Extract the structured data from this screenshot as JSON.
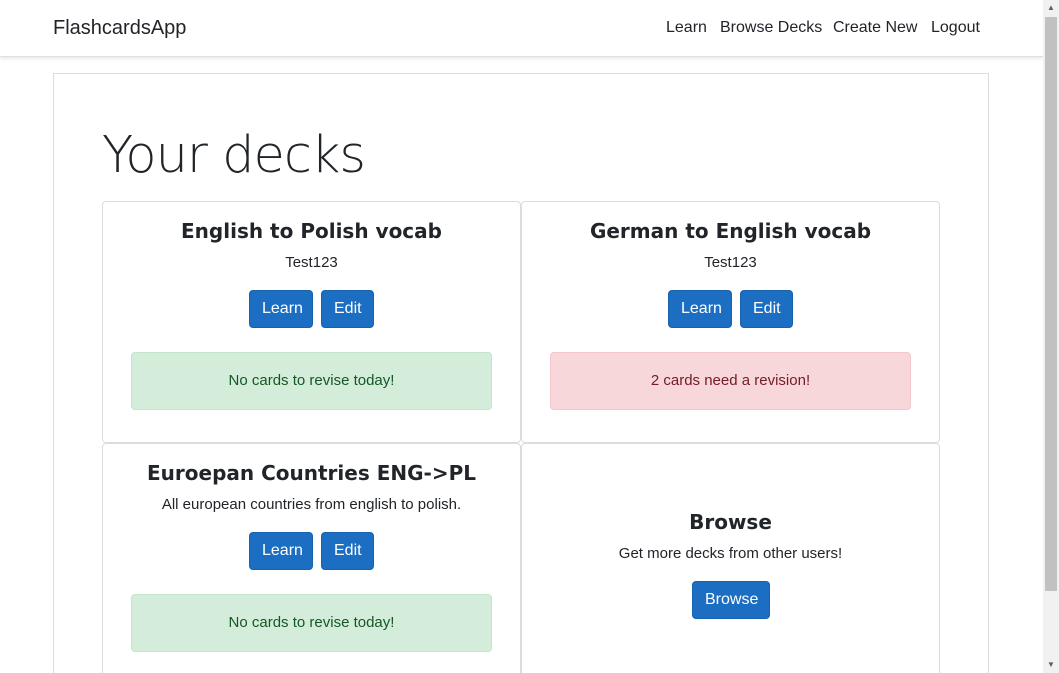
{
  "nav": {
    "brand": "FlashcardsApp",
    "links": [
      "Learn",
      "Browse Decks",
      "Create New",
      "Logout"
    ]
  },
  "page": {
    "title": "Your decks"
  },
  "decks": [
    {
      "title": "English to Polish vocab",
      "description": "Test123",
      "learn_label": "Learn",
      "edit_label": "Edit",
      "status": "No cards to revise today!",
      "status_type": "success"
    },
    {
      "title": "German to English vocab",
      "description": "Test123",
      "learn_label": "Learn",
      "edit_label": "Edit",
      "status": "2 cards need a revision!",
      "status_type": "danger"
    },
    {
      "title": "Euroepan Countries ENG->PL",
      "description": "All european countries from english to polish.",
      "learn_label": "Learn",
      "edit_label": "Edit",
      "status": "No cards to revise today!",
      "status_type": "success"
    }
  ],
  "browse_card": {
    "title": "Browse",
    "description": "Get more decks from other users!",
    "button_label": "Browse"
  },
  "colors": {
    "primary": "#1b6ec2",
    "success_bg": "#d4edda",
    "danger_bg": "#f8d7da"
  },
  "icons": {
    "scroll_up": "arrow-up-icon",
    "scroll_down": "arrow-down-icon"
  }
}
